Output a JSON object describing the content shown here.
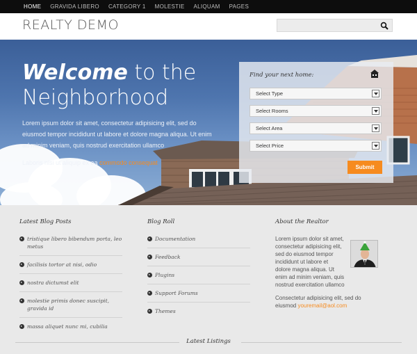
{
  "nav": {
    "items": [
      "HOME",
      "GRAVIDA LIBERO",
      "CATEGORY 1",
      "MOLESTIE",
      "ALIQUAM",
      "PAGES"
    ],
    "active_index": 0
  },
  "header": {
    "logo": "REALTY DEMO",
    "search": {
      "value": "",
      "placeholder": ""
    },
    "icons": {
      "search": "search-icon"
    }
  },
  "hero": {
    "title_bold": "Welcome",
    "title_rest": " to the",
    "title_line2": "Neighborhood",
    "paragraph": "Lorem ipsum dolor sit amet, consectetur adipisicing elit, sed do eiusmod tempor incididunt ut labore et dolore magna aliqua. Ut enim ad minim veniam, quis nostrud exercitation ullamco",
    "paragraph2": "Laboris nisi ut aliquip ex ea ",
    "paragraph2_link": "commodo consequat"
  },
  "finder": {
    "title": "Find your next home:",
    "icon": "house-icon",
    "selects": [
      "Select Type",
      "Select Rooms",
      "Select Area",
      "Select Price"
    ],
    "submit_label": "Submit"
  },
  "blog_posts": {
    "title": "Latest Blog Posts",
    "items": [
      "tristique libero bibendum porta, leo metus",
      "facilisis tortor at nisi, odio",
      "nostra dictumst elit",
      "molestie primis donec suscipit, gravida id",
      "massa aliquet nunc mi, cubilia"
    ]
  },
  "blog_roll": {
    "title": "Blog Roll",
    "items": [
      "Documentation",
      "Feedback",
      "Plugins",
      "Support Forums",
      "Themes"
    ]
  },
  "about": {
    "title": "About the Realtor",
    "paragraph": "Lorem ipsum dolor sit amet, consectetur adipisicing elit, sed do eiusmod tempor incididunt ut labore et dolore magna aliqua. Ut enim ad minim veniam, quis nostrud exercitation ullamco",
    "paragraph2": "Consectetur adipisicing elit, sed do eiusmod ",
    "email": "youremail@aol.com"
  },
  "latest_listings": {
    "title": "Latest Listings"
  },
  "colors": {
    "accent": "#f68b1f",
    "nav_bg": "#0d0d0d",
    "body_bg": "#e9e9e9"
  }
}
